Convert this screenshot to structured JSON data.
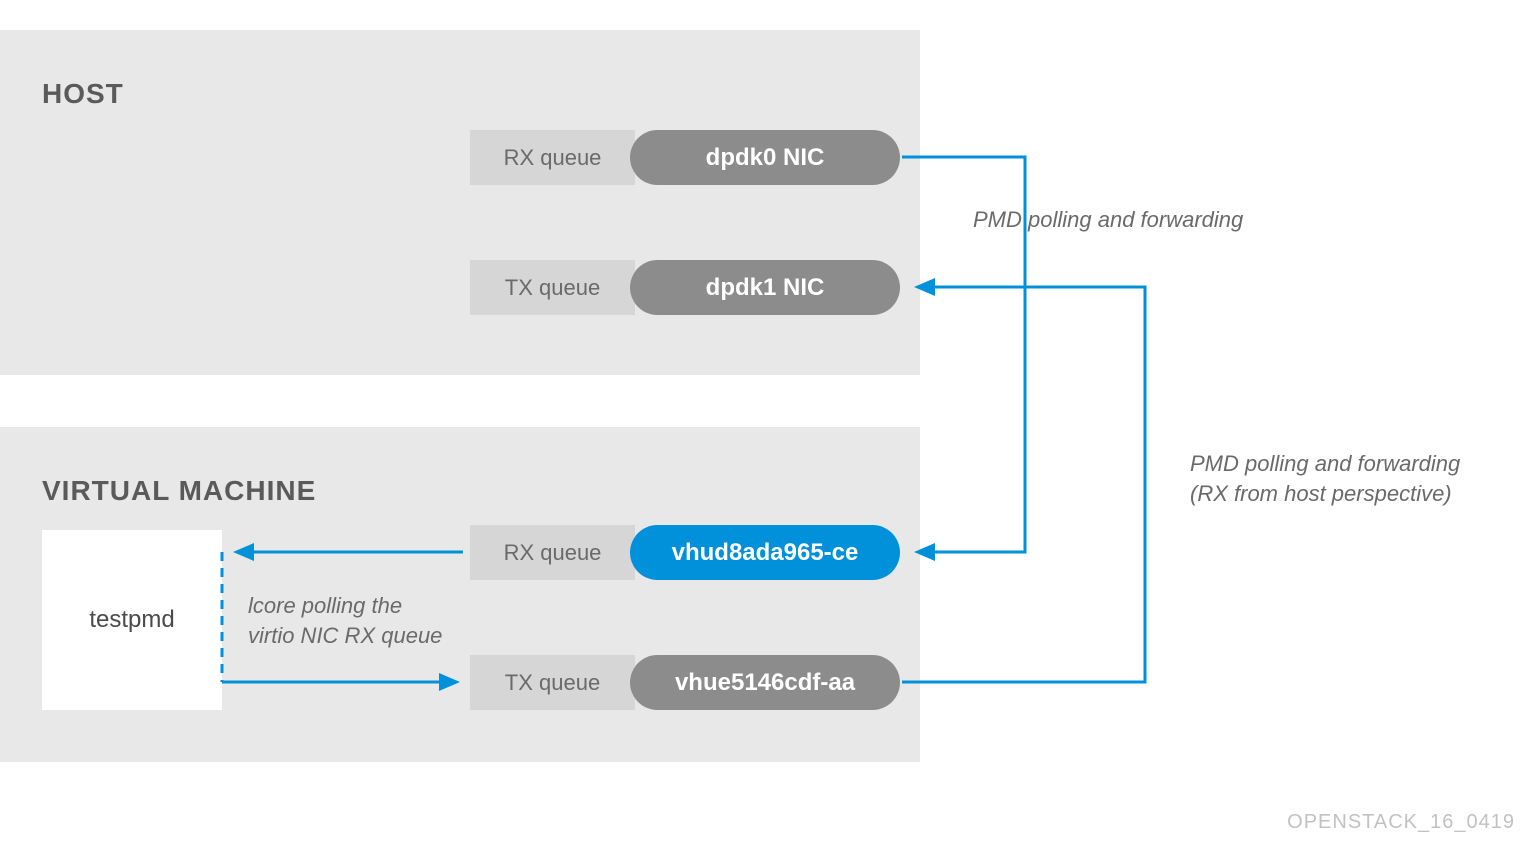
{
  "host": {
    "title": "HOST",
    "rx": {
      "queue_label": "RX queue",
      "nic_label": "dpdk0 NIC"
    },
    "tx": {
      "queue_label": "TX queue",
      "nic_label": "dpdk1 NIC"
    }
  },
  "vm": {
    "title": "VIRTUAL MACHINE",
    "rx": {
      "queue_label": "RX queue",
      "nic_label": "vhud8ada965-ce"
    },
    "tx": {
      "queue_label": "TX queue",
      "nic_label": "vhue5146cdf-aa"
    },
    "testpmd_label": "testpmd"
  },
  "annotations": {
    "pmd_top": "PMD polling and forwarding",
    "pmd_right_line1": "PMD polling and forwarding",
    "pmd_right_line2": "(RX from host perspective)",
    "lcore_line1": "lcore polling the",
    "lcore_line2": "virtio NIC RX queue"
  },
  "footer": "OPENSTACK_16_0419",
  "colors": {
    "accent_blue": "#0091da",
    "nic_grey": "#8c8c8c",
    "panel": "#e8e8e8",
    "queue_box": "#d6d6d6"
  }
}
